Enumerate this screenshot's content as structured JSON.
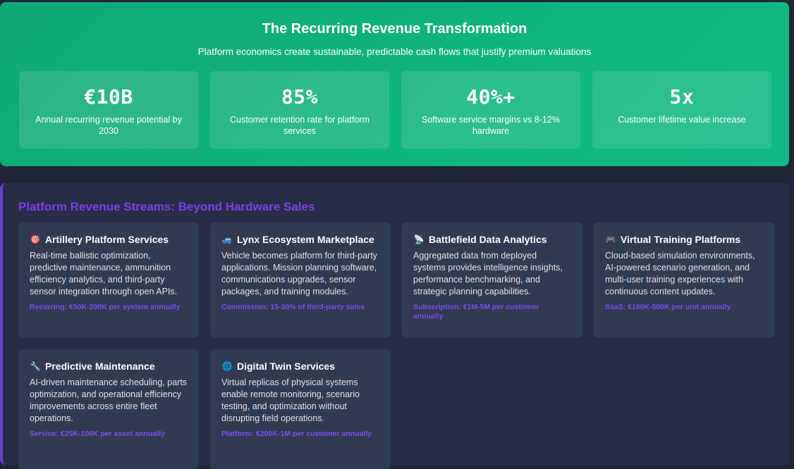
{
  "hero": {
    "title": "The Recurring Revenue Transformation",
    "subtitle": "Platform economics create sustainable, predictable cash flows that justify premium valuations",
    "metrics": [
      {
        "value": "€10B",
        "label": "Annual recurring revenue potential by 2030"
      },
      {
        "value": "85%",
        "label": "Customer retention rate for platform services"
      },
      {
        "value": "40%+",
        "label": "Software service margins vs 8-12% hardware"
      },
      {
        "value": "5x",
        "label": "Customer lifetime value increase"
      }
    ]
  },
  "streams": {
    "title": "Platform Revenue Streams: Beyond Hardware Sales",
    "cards": [
      {
        "icon": "🎯",
        "icon_name": "target-icon",
        "title": "Artillery Platform Services",
        "description": "Real-time ballistic optimization, predictive maintenance, ammunition efficiency analytics, and third-party sensor integration through open APIs.",
        "pricing": "Recurring: €50K-200K per system annually"
      },
      {
        "icon": "🚙",
        "icon_name": "vehicle-icon",
        "title": "Lynx Ecosystem Marketplace",
        "description": "Vehicle becomes platform for third-party applications. Mission planning software, communications upgrades, sensor packages, and training modules.",
        "pricing": "Commission: 15-30% of third-party sales"
      },
      {
        "icon": "📡",
        "icon_name": "satellite-dish-icon",
        "title": "Battlefield Data Analytics",
        "description": "Aggregated data from deployed systems provides intelligence insights, performance benchmarking, and strategic planning capabilities.",
        "pricing": "Subscription: €1M-5M per customer annually"
      },
      {
        "icon": "🎮",
        "icon_name": "game-controller-icon",
        "title": "Virtual Training Platforms",
        "description": "Cloud-based simulation environments, AI-powered scenario generation, and multi-user training experiences with continuous content updates.",
        "pricing": "SaaS: €100K-500K per unit annually"
      },
      {
        "icon": "🔧",
        "icon_name": "wrench-icon",
        "title": "Predictive Maintenance",
        "description": "AI-driven maintenance scheduling, parts optimization, and operational efficiency improvements across entire fleet operations.",
        "pricing": "Service: €25K-100K per asset annually"
      },
      {
        "icon": "🌐",
        "icon_name": "globe-icon",
        "title": "Digital Twin Services",
        "description": "Virtual replicas of physical systems enable remote monitoring, scenario testing, and optimization without disrupting field operations.",
        "pricing": "Platform: €200K-1M per customer annually"
      }
    ]
  }
}
